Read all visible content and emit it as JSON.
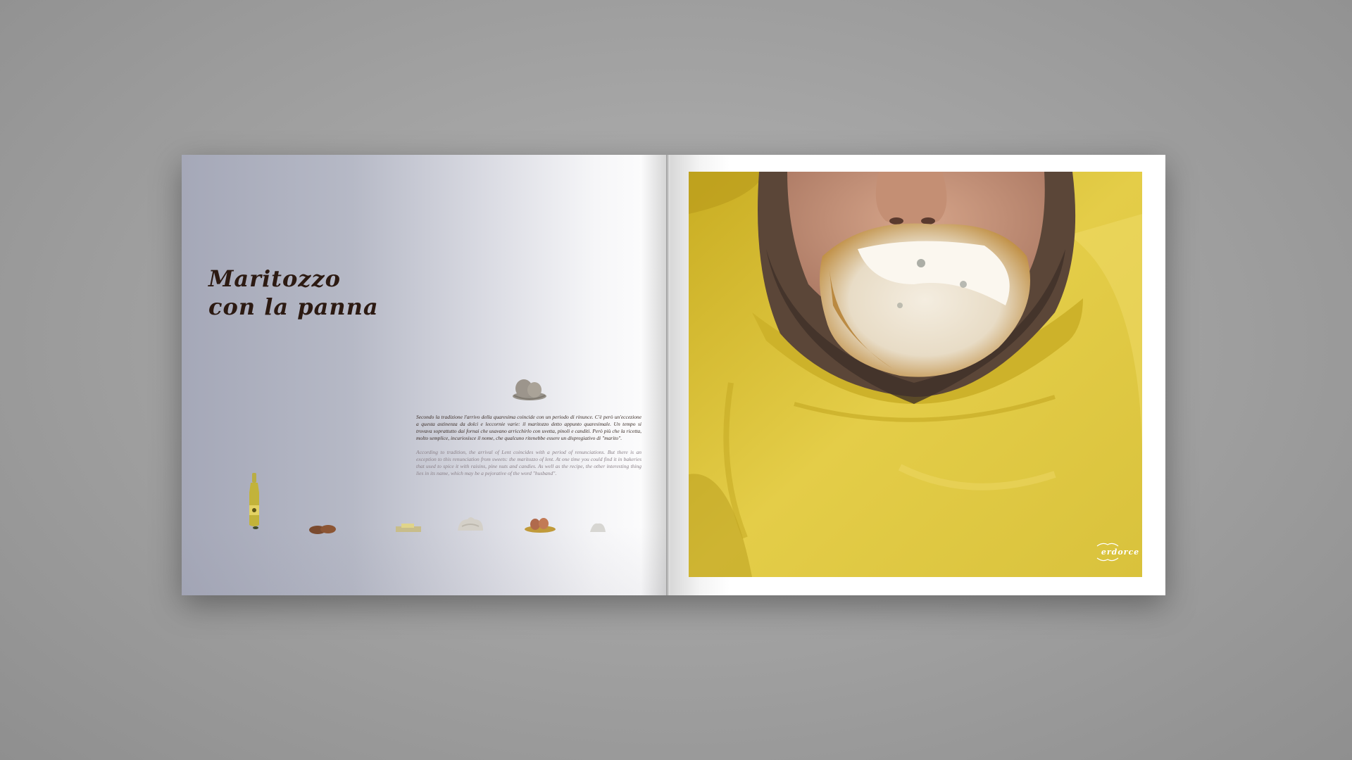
{
  "spread": {
    "left_page": {
      "title_line1": "Maritozzo",
      "title_line2": "con la panna",
      "body_italian": "Secondo la tradizione l'arrivo della quaresima coincide con un periodo di rinunce. C'è però un'eccezione a questa astinenza da dolci e leccornie varie: il maritozzo detto appunto quaresimale. Un tempo si trovava soprattutto dai fornai che usavano arricchirlo con uvetta, pinoli e canditi. Però più che la ricetta, molto semplice, incuriosisce il nome, che qualcuno ritenebbe essere un dispregiativo di \"marito\".",
      "body_english": "According to tradition, the arrival of Lent coincides with a period of renunciations. But there is an exception to this renunciation from sweets: the maritozzo of lent. At one time you could find it in bakeries that used to spice it with raisins, pine nuts and candies. As well as the recipe, the other interesting thing lies in its name, which may be a pejorative of the word \"husband\".",
      "icon": "eggs-in-nest-icon",
      "ingredients": [
        "oil-bottle-icon",
        "almonds-icon",
        "butter-icon",
        "cream-icon",
        "eggs-in-nest-icon",
        "sugar-icon"
      ]
    },
    "right_page": {
      "photo": "man-eating-maritozzo-photo",
      "brand": "erdorce"
    }
  },
  "colors": {
    "background": "#a3a3a3",
    "title": "#2c1a12",
    "shirt": "#d8bd2e"
  }
}
